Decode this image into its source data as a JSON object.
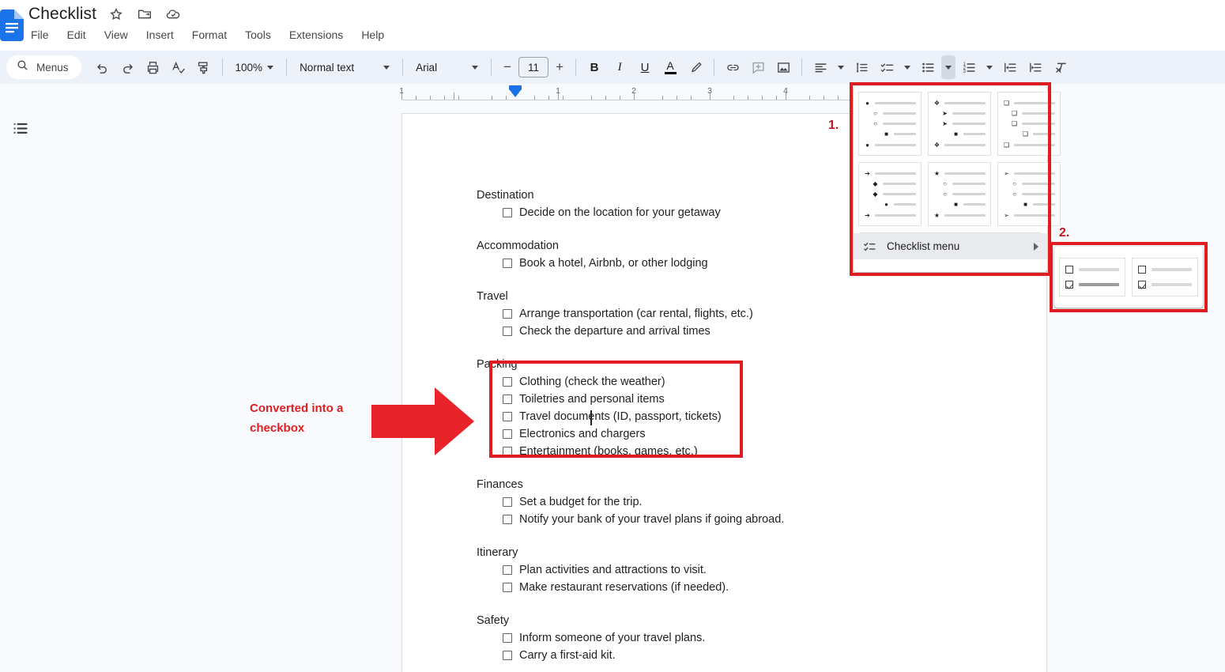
{
  "app": {
    "doc_title": "Checklist",
    "title_icons": [
      "star-icon",
      "move-to-folder-icon",
      "cloud-saved-icon"
    ],
    "menus": [
      "File",
      "Edit",
      "View",
      "Insert",
      "Format",
      "Tools",
      "Extensions",
      "Help"
    ]
  },
  "toolbar": {
    "search_label": "Menus",
    "zoom_value": "100%",
    "paragraph_style": "Normal text",
    "font_family": "Arial",
    "font_size": "11",
    "bold": "B",
    "italic": "I",
    "underline": "U",
    "text_color": "A",
    "icons": [
      "undo-icon",
      "redo-icon",
      "print-icon",
      "spellcheck-icon",
      "paint-format-icon",
      "highlight-icon",
      "link-icon",
      "comment-icon",
      "image-icon",
      "align-icon",
      "line-spacing-icon",
      "checklist-icon",
      "bulleted-list-icon",
      "numbered-list-icon",
      "decrease-indent-icon",
      "increase-indent-icon",
      "clear-formatting-icon"
    ]
  },
  "ruler": {
    "numbers": [
      "1",
      "1",
      "2",
      "3",
      "4"
    ],
    "indent_marker": "left-indent-marker"
  },
  "sidebar": {
    "outline_icon": "document-outline-icon"
  },
  "document": {
    "sections": [
      {
        "heading": "Destination",
        "items": [
          "Decide on the location for your getaway"
        ]
      },
      {
        "heading": "Accommodation",
        "items": [
          "Book a hotel, Airbnb, or other lodging"
        ]
      },
      {
        "heading": "Travel",
        "items": [
          "Arrange transportation (car rental, flights, etc.)",
          "Check the departure and arrival times"
        ]
      },
      {
        "heading": "Packing",
        "items": [
          "Clothing (check the weather)",
          "Toiletries and personal items",
          "Travel documents (ID, passport, tickets)",
          "Electronics and chargers",
          "Entertainment (books, games, etc.)"
        ]
      },
      {
        "heading": "Finances",
        "items": [
          "Set a budget for the trip.",
          "Notify your bank of your travel plans if going abroad."
        ]
      },
      {
        "heading": "Itinerary",
        "items": [
          "Plan activities and attractions to visit.",
          "Make restaurant reservations (if needed)."
        ]
      },
      {
        "heading": "Safety",
        "items": [
          "Inform someone of your travel plans.",
          "Carry a first-aid kit."
        ]
      }
    ]
  },
  "bullet_panel": {
    "presets": [
      {
        "name": "disc-circle-square",
        "marks": [
          "●",
          "○",
          "○",
          "■",
          "●"
        ]
      },
      {
        "name": "diamond-arrow-square",
        "marks": [
          "❖",
          "➤",
          "➤",
          "■",
          "❖"
        ]
      },
      {
        "name": "square-outline",
        "marks": [
          "❑",
          "❑",
          "❑",
          "❑",
          "❑"
        ]
      },
      {
        "name": "arrow-diamond-disc",
        "marks": [
          "➔",
          "◆",
          "◆",
          "●",
          "➔"
        ]
      },
      {
        "name": "star-circle-square",
        "marks": [
          "★",
          "○",
          "○",
          "■",
          "★"
        ]
      },
      {
        "name": "arrowhead-circle-square",
        "marks": [
          "➢",
          "○",
          "○",
          "■",
          "➢"
        ]
      }
    ],
    "checklist_menu_label": "Checklist menu"
  },
  "checklist_submenu": {
    "options": [
      {
        "name": "checklist-with-strikethrough",
        "strikethrough": true
      },
      {
        "name": "checklist-without-strikethrough",
        "strikethrough": false
      }
    ]
  },
  "annotations": {
    "callout_text": "Converted into a checkbox",
    "step_1": "1.",
    "step_2": "2.",
    "accent_color": "#e11b22"
  }
}
